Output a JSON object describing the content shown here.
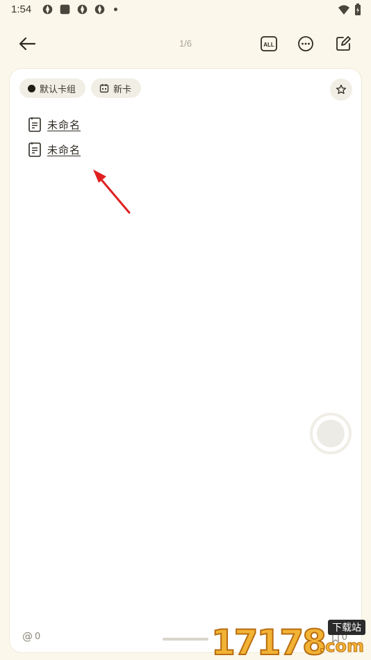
{
  "status_bar": {
    "time": "1:54",
    "icons": [
      "aperture-icon",
      "square-app-icon",
      "aperture-icon",
      "aperture-icon"
    ],
    "right_icons": [
      "wifi-icon",
      "battery-icon"
    ]
  },
  "topbar": {
    "page_indicator": "1/6",
    "all_label": "ALL",
    "icons": [
      "back-arrow-icon",
      "all-icon",
      "more-icon",
      "edit-icon"
    ]
  },
  "card": {
    "tags": [
      {
        "label": "默认卡组",
        "icon": "dot-icon"
      },
      {
        "label": "新卡",
        "icon": "calendar-icon"
      }
    ],
    "star_icon": "star-icon",
    "notes": [
      {
        "title": "未命名",
        "icon": "note-icon"
      },
      {
        "title": "未命名",
        "icon": "note-icon"
      }
    ],
    "footer": {
      "mention_count": "0",
      "bookmark_count": "0"
    }
  },
  "watermark": {
    "number": "17178",
    "tag": "下载站",
    "suffix": ".com"
  },
  "colors": {
    "background": "#fbf7ea",
    "card": "#ffffff",
    "chip": "#f1eee5",
    "annotation_arrow": "#e02020"
  }
}
